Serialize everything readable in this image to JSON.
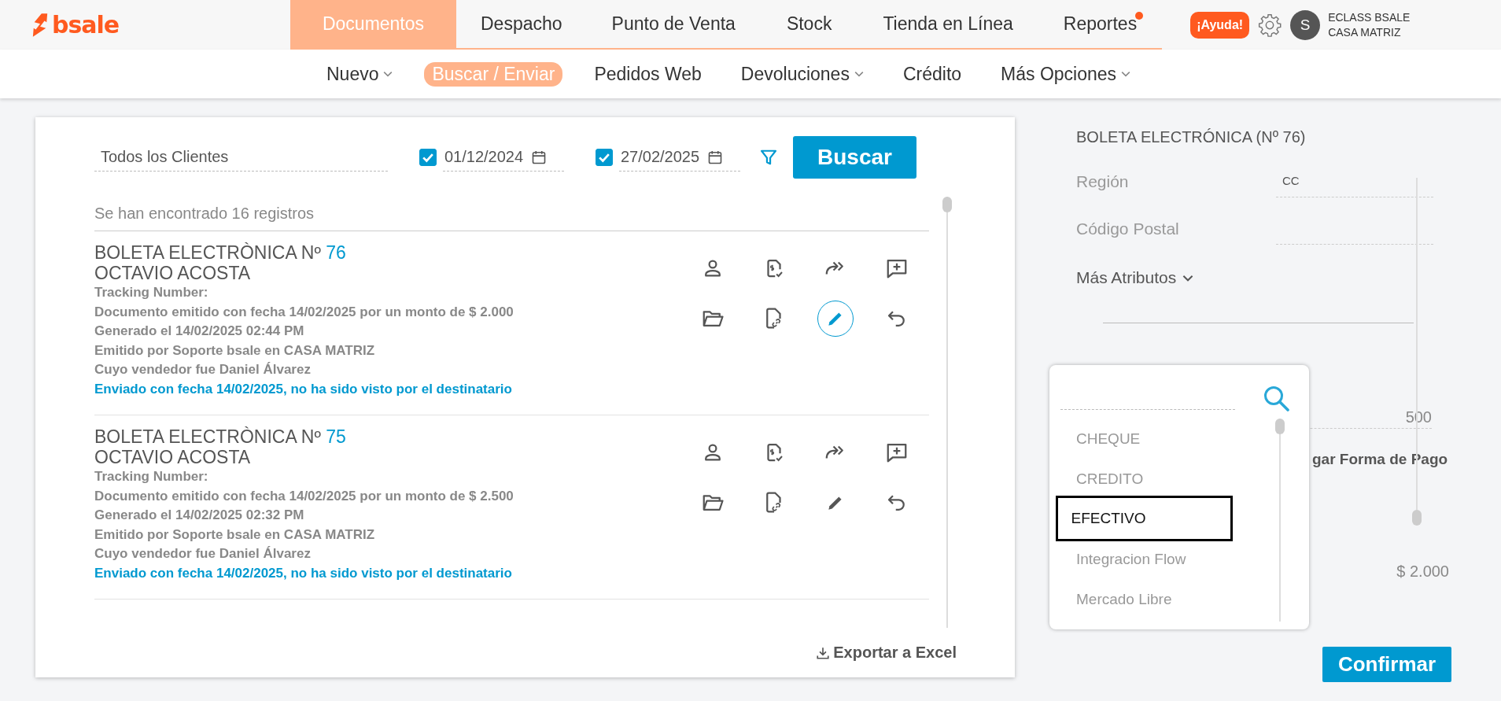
{
  "logo": {
    "text": "bsale"
  },
  "main_nav": [
    {
      "label": "Documentos",
      "selected": true,
      "notification": false
    },
    {
      "label": "Despacho",
      "selected": false,
      "notification": false
    },
    {
      "label": "Punto de Venta",
      "selected": false,
      "notification": false
    },
    {
      "label": "Stock",
      "selected": false,
      "notification": false
    },
    {
      "label": "Tienda en Línea",
      "selected": false,
      "notification": false
    },
    {
      "label": "Reportes",
      "selected": false,
      "notification": true
    }
  ],
  "help_button": "¡Ayuda!",
  "user": {
    "initial": "S",
    "name": "ECLASS BSALE",
    "branch": "CASA MATRIZ"
  },
  "sub_nav": [
    {
      "label": "Nuevo",
      "selected": false,
      "dropdown": true
    },
    {
      "label": "Buscar / Enviar",
      "selected": true,
      "dropdown": false
    },
    {
      "label": "Pedidos Web",
      "selected": false,
      "dropdown": false
    },
    {
      "label": "Devoluciones",
      "selected": false,
      "dropdown": true
    },
    {
      "label": "Crédito",
      "selected": false,
      "dropdown": false
    },
    {
      "label": "Más Opciones",
      "selected": false,
      "dropdown": true
    }
  ],
  "search": {
    "client": "Todos los Clientes",
    "date_from": {
      "checked": true,
      "value": "01/12/2024"
    },
    "date_to": {
      "checked": true,
      "value": "27/02/2025"
    },
    "button": "Buscar"
  },
  "result_count": "Se han encontrado 16 registros",
  "documents": [
    {
      "type_label": "BOLETA ELECTRÒNICA Nº",
      "number": "76",
      "customer": "OCTAVIO ACOSTA",
      "lines": [
        "Tracking Number:",
        "Documento emitido con fecha 14/02/2025 por un monto de $ 2.000",
        "Generado el 14/02/2025 02:44 PM",
        "Emitido por Soporte bsale en CASA MATRIZ",
        "Cuyo vendedor fue Daniel Álvarez"
      ],
      "sent_status": "Enviado con fecha 14/02/2025, no ha sido visto por el destinatario",
      "edit_selected": true
    },
    {
      "type_label": "BOLETA ELECTRÒNICA Nº",
      "number": "75",
      "customer": "OCTAVIO ACOSTA",
      "lines": [
        "Tracking Number:",
        "Documento emitido con fecha 14/02/2025 por un monto de $ 2.500",
        "Generado el 14/02/2025 02:32 PM",
        "Emitido por Soporte bsale en CASA MATRIZ",
        "Cuyo vendedor fue Daniel Álvarez"
      ],
      "sent_status": "Enviado con fecha 14/02/2025, no ha sido visto por el destinatario",
      "edit_selected": false
    }
  ],
  "export": "Exportar a Excel",
  "detail": {
    "title": "BOLETA ELECTRÓNICA (Nº 76)",
    "fields": [
      {
        "label": "Región",
        "value": "CC"
      },
      {
        "label": "Código Postal"
      }
    ],
    "more": "Más Atributos",
    "amount": "500",
    "payment_fragment": "gar Forma de Pago",
    "total": "$ 2.000",
    "confirm": "Confirmar"
  },
  "payment_dropdown": {
    "options": [
      {
        "label": "CHEQUE",
        "selected": false
      },
      {
        "label": "CREDITO",
        "selected": false
      },
      {
        "label": "EFECTIVO",
        "selected": true
      },
      {
        "label": "Integracion Flow",
        "selected": false
      },
      {
        "label": "Mercado Libre",
        "selected": false
      }
    ]
  }
}
